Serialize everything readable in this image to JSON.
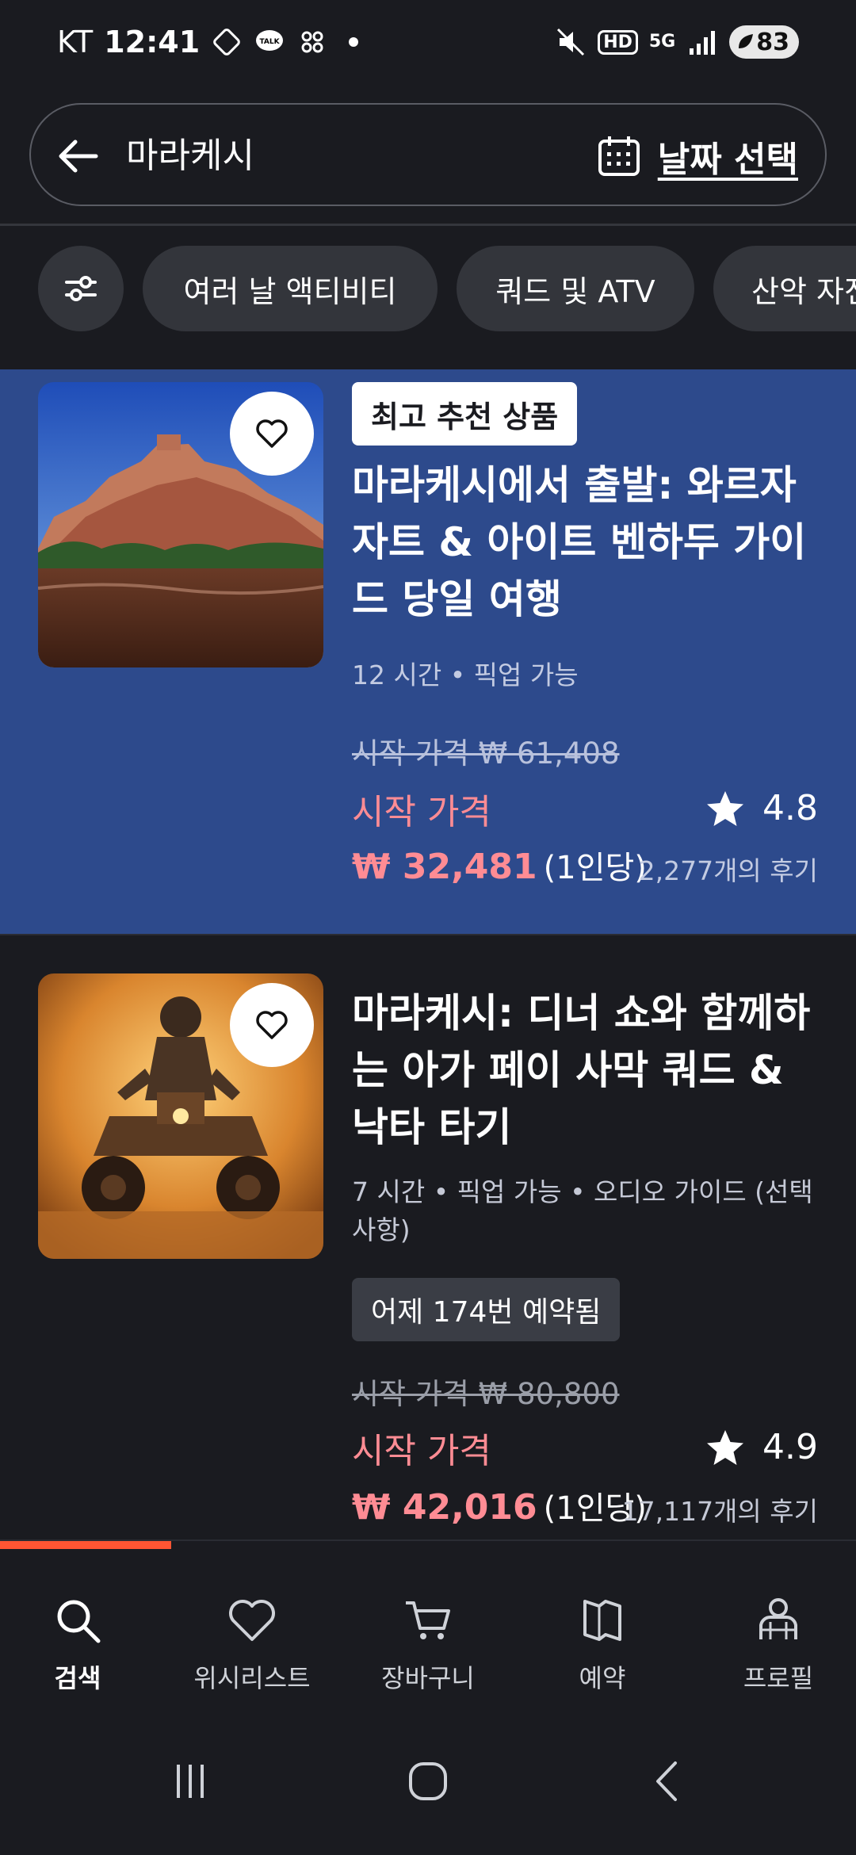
{
  "status_bar": {
    "carrier": "KT",
    "time": "12:41",
    "network": "5G",
    "hd": "HD",
    "battery": "83"
  },
  "search": {
    "term": "마라케시",
    "date_button": "날짜 선택"
  },
  "filters": {
    "chips": [
      "여러 날 액티비티",
      "쿼드 및 ATV",
      "산악 자전거"
    ]
  },
  "results": [
    {
      "badge": "최고 추천 상품",
      "title": "마라케시에서 출발: 와르자자트 & 아이트 벤하두 가이드 당일 여행",
      "meta": "12 시간 • 픽업 가능",
      "old_price": "시작 가격 ₩ 61,408",
      "from_label": "시작 가격",
      "price": "₩ 32,481",
      "per_person": "(1인당)",
      "rating": "4.8",
      "reviews": "2,277개의 후기",
      "highlight_color": "#2d4a8c"
    },
    {
      "title": "마라케시: 디너 쇼와 함께하는 아가 페이 사막 쿼드 & 낙타 타기",
      "meta": "7 시간 • 픽업 가능 • 오디오 가이드 (선택 사항)",
      "booked_badge": "어제 174번 예약됨",
      "old_price": "시작 가격 ₩ 80,800",
      "from_label": "시작 가격",
      "price": "₩ 42,016",
      "per_person": "(1인당)",
      "rating": "4.9",
      "reviews": "17,117개의 후기"
    }
  ],
  "scroll_progress": 0.2,
  "bottom_nav": [
    {
      "label": "검색",
      "icon": "search-icon",
      "active": true
    },
    {
      "label": "위시리스트",
      "icon": "heart-icon",
      "active": false
    },
    {
      "label": "장바구니",
      "icon": "cart-icon",
      "active": false
    },
    {
      "label": "예약",
      "icon": "ticket-icon",
      "active": false
    },
    {
      "label": "프로필",
      "icon": "profile-icon",
      "active": false
    }
  ],
  "colors": {
    "background": "#1a1b20",
    "accent": "#ff5533",
    "price": "#ff8c94",
    "chip": "#33353b"
  }
}
